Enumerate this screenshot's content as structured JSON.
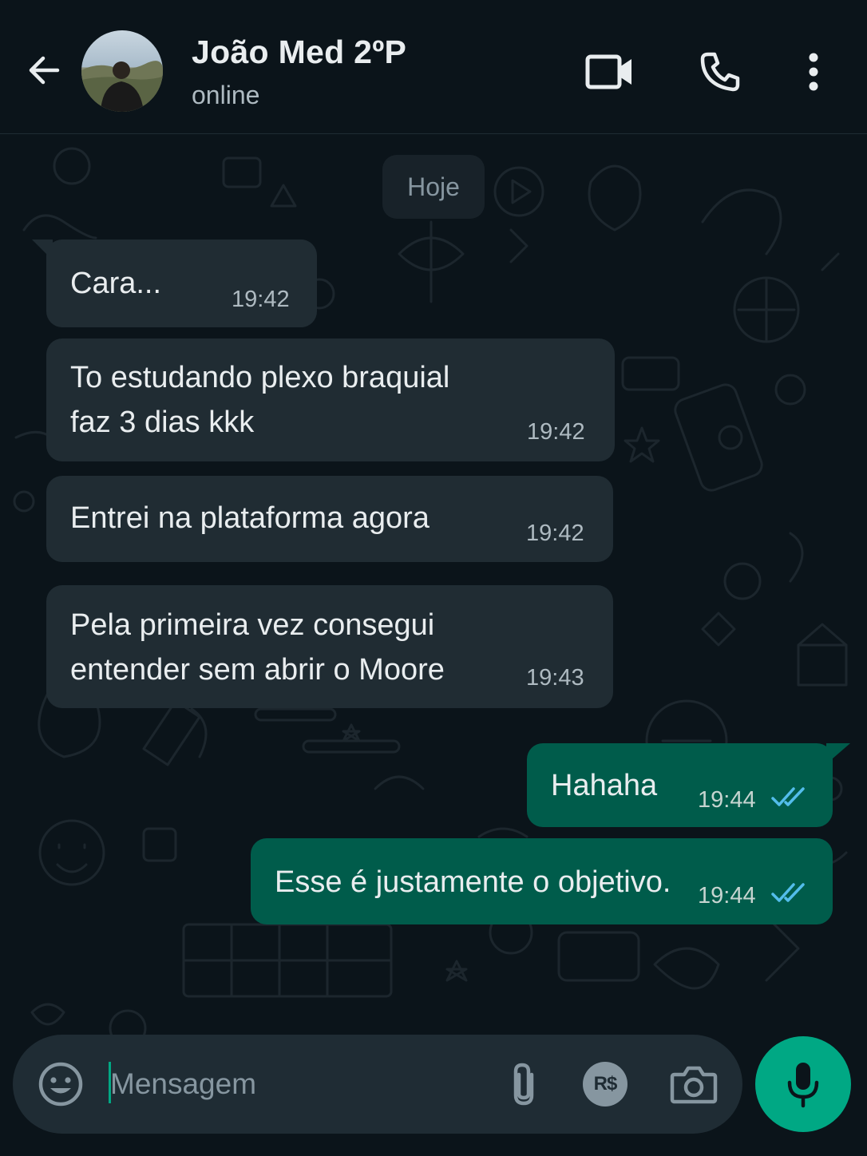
{
  "header": {
    "contact_name": "João Med 2ºP",
    "status": "online"
  },
  "chat": {
    "date_divider": "Hoje",
    "messages": [
      {
        "direction": "incoming",
        "text": "Cara...",
        "time": "19:42"
      },
      {
        "direction": "incoming",
        "text": "To estudando plexo braquial\nfaz 3 dias kkk",
        "time": "19:42"
      },
      {
        "direction": "incoming",
        "text": "Entrei na plataforma agora",
        "time": "19:42"
      },
      {
        "direction": "incoming",
        "text": "Pela primeira vez consegui\nentender sem abrir o Moore",
        "time": "19:43"
      },
      {
        "direction": "outgoing",
        "text": "Hahaha",
        "time": "19:44",
        "status": "read"
      },
      {
        "direction": "outgoing",
        "text": "Esse é justamente o objetivo.",
        "time": "19:44",
        "status": "read"
      }
    ]
  },
  "composer": {
    "placeholder": "Mensagem",
    "value": "",
    "payment_label": "R$"
  },
  "icons": {
    "back": "arrow-left-icon",
    "video": "video-camera-icon",
    "call": "phone-icon",
    "menu": "more-vertical-icon",
    "emoji": "emoji-icon",
    "attach": "paperclip-icon",
    "payment": "payment-icon",
    "camera": "camera-icon",
    "mic": "microphone-icon",
    "read_receipt": "double-check-icon"
  },
  "colors": {
    "background": "#0b141a",
    "incoming_bubble": "#202c33",
    "outgoing_bubble": "#005c4b",
    "accent": "#00a884",
    "read_tick": "#53bdeb"
  }
}
